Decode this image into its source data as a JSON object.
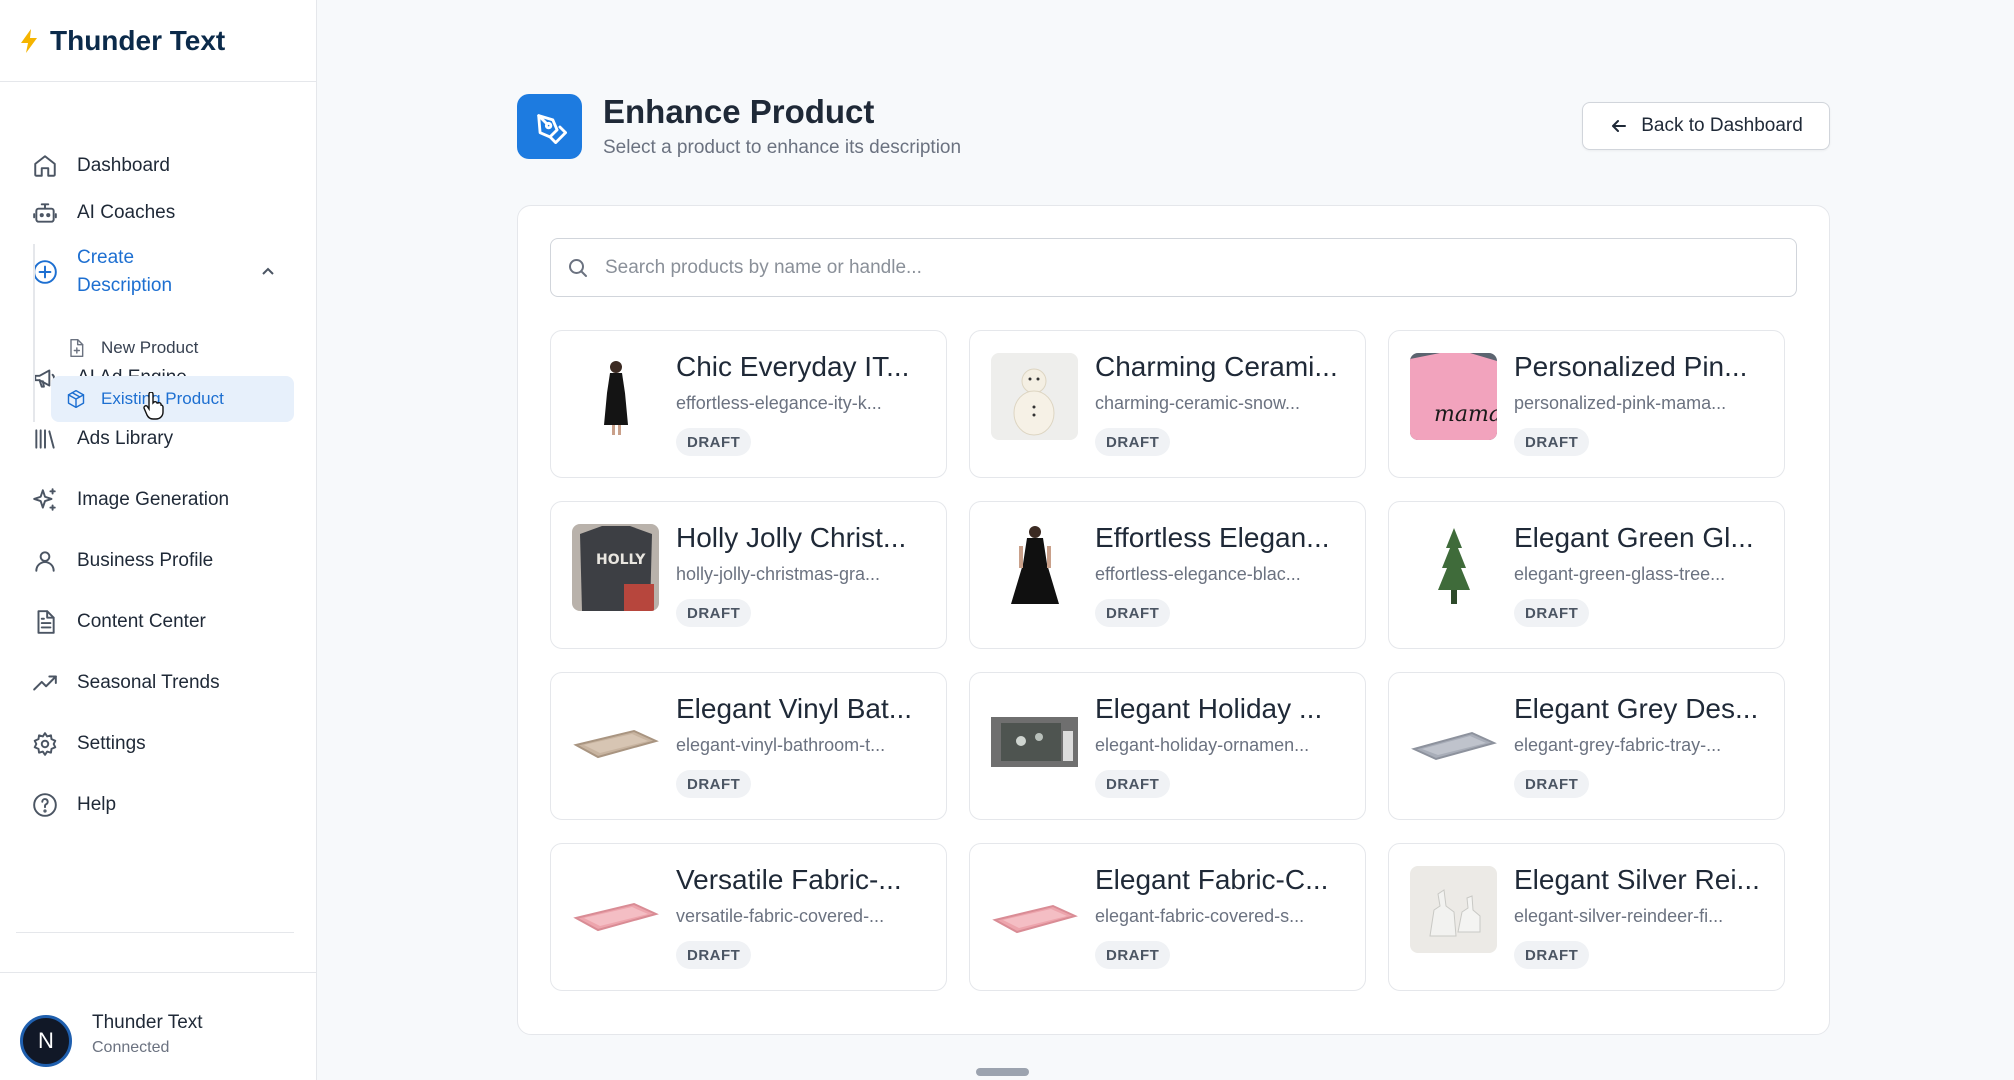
{
  "brand": {
    "name": "Thunder Text"
  },
  "sidebar": {
    "items": [
      {
        "label": "Dashboard",
        "icon": "home-icon"
      },
      {
        "label": "AI Coaches",
        "icon": "bot-icon"
      },
      {
        "label": "Create Description",
        "icon": "plus-circle-icon"
      },
      {
        "label": "AI Ad Engine",
        "icon": "megaphone-icon"
      },
      {
        "label": "Ads Library",
        "icon": "library-icon"
      },
      {
        "label": "Image Generation",
        "icon": "sparkles-icon"
      },
      {
        "label": "Business Profile",
        "icon": "user-icon"
      },
      {
        "label": "Content Center",
        "icon": "file-text-icon"
      },
      {
        "label": "Seasonal Trends",
        "icon": "trending-up-icon"
      },
      {
        "label": "Settings",
        "icon": "gear-icon"
      },
      {
        "label": "Help",
        "icon": "help-circle-icon"
      }
    ],
    "create_description_line1": "Create",
    "create_description_line2": "Description",
    "sub_items": [
      {
        "label": "New Product",
        "icon": "file-plus-icon"
      },
      {
        "label": "Existing Product",
        "icon": "package-icon"
      }
    ],
    "accent_color": "#1d6fd1"
  },
  "user": {
    "initial": "N",
    "name": "Thunder Text",
    "status": "Connected"
  },
  "header": {
    "title": "Enhance Product",
    "subtitle": "Select a product to enhance its description",
    "back_label": "Back to Dashboard"
  },
  "search": {
    "placeholder": "Search products by name or handle...",
    "value": ""
  },
  "products": [
    {
      "title": "Chic Everyday IT...",
      "handle": "effortless-elegance-ity-k...",
      "status": "DRAFT"
    },
    {
      "title": "Charming Cerami...",
      "handle": "charming-ceramic-snow...",
      "status": "DRAFT"
    },
    {
      "title": "Personalized Pin...",
      "handle": "personalized-pink-mama...",
      "status": "DRAFT"
    },
    {
      "title": "Holly Jolly Christ...",
      "handle": "holly-jolly-christmas-gra...",
      "status": "DRAFT"
    },
    {
      "title": "Effortless Elegan...",
      "handle": "effortless-elegance-blac...",
      "status": "DRAFT"
    },
    {
      "title": "Elegant Green Gl...",
      "handle": "elegant-green-glass-tree...",
      "status": "DRAFT"
    },
    {
      "title": "Elegant Vinyl Bat...",
      "handle": "elegant-vinyl-bathroom-t...",
      "status": "DRAFT"
    },
    {
      "title": "Elegant Holiday ...",
      "handle": "elegant-holiday-ornamen...",
      "status": "DRAFT"
    },
    {
      "title": "Elegant Grey Des...",
      "handle": "elegant-grey-fabric-tray-...",
      "status": "DRAFT"
    },
    {
      "title": "Versatile Fabric-...",
      "handle": "versatile-fabric-covered-...",
      "status": "DRAFT"
    },
    {
      "title": "Elegant Fabric-C...",
      "handle": "elegant-fabric-covered-s...",
      "status": "DRAFT"
    },
    {
      "title": "Elegant Silver Rei...",
      "handle": "elegant-silver-reindeer-fi...",
      "status": "DRAFT"
    }
  ],
  "text_on_thumbnails": {
    "pink_shirt_text": "mama",
    "holly_shirt_text": "HOLLY"
  }
}
